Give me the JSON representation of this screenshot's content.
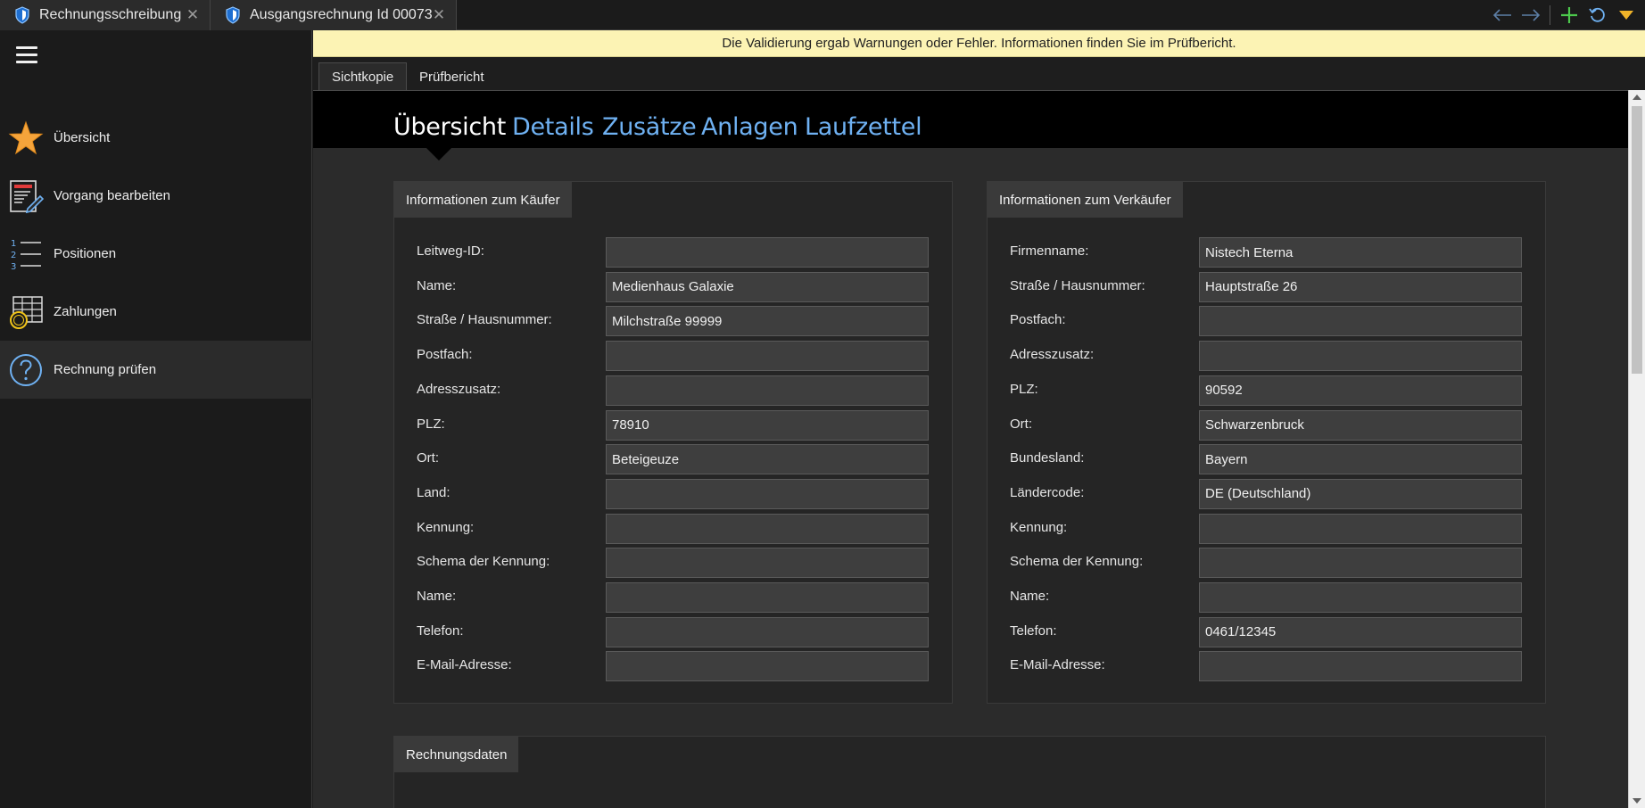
{
  "tabs": [
    {
      "label": "Rechnungsschreibung",
      "icon": "shield-icon"
    },
    {
      "label": "Ausgangsrechnung Id 00073",
      "icon": "shield-icon"
    }
  ],
  "toolbar": {
    "back": "arrow-left-icon",
    "forward": "arrow-right-icon",
    "add": "plus-icon",
    "refresh": "refresh-icon",
    "menu": "chevron-down-icon"
  },
  "sidebar": {
    "menu_icon": "hamburger-icon",
    "items": [
      {
        "label": "Übersicht",
        "icon": "star-icon"
      },
      {
        "label": "Vorgang bearbeiten",
        "icon": "edit-document-icon"
      },
      {
        "label": "Positionen",
        "icon": "numbered-list-icon"
      },
      {
        "label": "Zahlungen",
        "icon": "coin-table-icon"
      },
      {
        "label": "Rechnung prüfen",
        "icon": "question-icon"
      }
    ]
  },
  "warning": "Die Validierung ergab Warnungen oder Fehler. Informationen finden Sie im Prüfbericht.",
  "subtabs": [
    "Sichtkopie",
    "Prüfbericht"
  ],
  "sections": [
    "Übersicht",
    "Details",
    "Zusätze",
    "Anlagen",
    "Laufzettel"
  ],
  "buyer": {
    "title": "Informationen zum Käufer",
    "fields": [
      {
        "label": "Leitweg-ID:",
        "value": ""
      },
      {
        "label": "Name:",
        "value": "Medienhaus Galaxie"
      },
      {
        "label": "Straße / Hausnummer:",
        "value": "Milchstraße 99999"
      },
      {
        "label": "Postfach:",
        "value": ""
      },
      {
        "label": "Adresszusatz:",
        "value": ""
      },
      {
        "label": "PLZ:",
        "value": "78910"
      },
      {
        "label": "Ort:",
        "value": "Beteigeuze"
      },
      {
        "label": "Land:",
        "value": ""
      },
      {
        "label": "Kennung:",
        "value": ""
      },
      {
        "label": "Schema der Kennung:",
        "value": ""
      },
      {
        "label": "Name:",
        "value": ""
      },
      {
        "label": "Telefon:",
        "value": ""
      },
      {
        "label": "E-Mail-Adresse:",
        "value": ""
      }
    ]
  },
  "seller": {
    "title": "Informationen zum Verkäufer",
    "fields": [
      {
        "label": "Firmenname:",
        "value": "Nistech Eterna"
      },
      {
        "label": "Straße / Hausnummer:",
        "value": "Hauptstraße 26"
      },
      {
        "label": "Postfach:",
        "value": ""
      },
      {
        "label": "Adresszusatz:",
        "value": ""
      },
      {
        "label": "PLZ:",
        "value": "90592"
      },
      {
        "label": "Ort:",
        "value": "Schwarzenbruck"
      },
      {
        "label": "Bundesland:",
        "value": "Bayern"
      },
      {
        "label": "Ländercode:",
        "value": "DE (Deutschland)"
      },
      {
        "label": "Kennung:",
        "value": ""
      },
      {
        "label": "Schema der Kennung:",
        "value": ""
      },
      {
        "label": "Name:",
        "value": ""
      },
      {
        "label": "Telefon:",
        "value": "0461/12345"
      },
      {
        "label": "E-Mail-Adresse:",
        "value": ""
      }
    ]
  },
  "invoice": {
    "title": "Rechnungsdaten"
  },
  "colors": {
    "accent": "#6fb1f2",
    "warning_bg": "#fcf3b4",
    "star": "#f5a43b"
  }
}
